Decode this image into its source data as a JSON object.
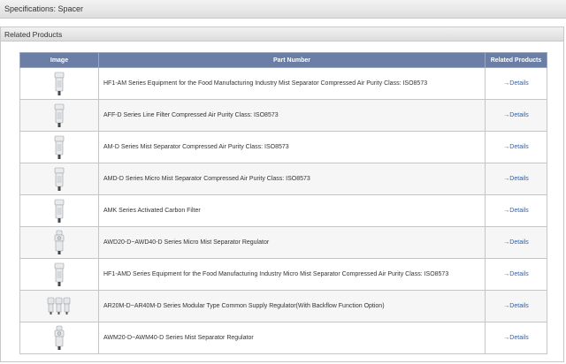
{
  "spec_title": "Specifications: Spacer",
  "related_title": "Related Products",
  "table": {
    "headers": [
      "Image",
      "Part Number",
      "Related Products"
    ],
    "rows": [
      {
        "part": "HF1-AM Series Equipment for the Food Manufacturing Industry Mist Separator Compressed Air Purity Class: ISO8573",
        "link": "Details",
        "arrow": "→",
        "img": "single-unit"
      },
      {
        "part": "AFF-D Series Line Filter Compressed Air Purity Class: ISO8573",
        "link": "Details",
        "arrow": "→",
        "img": "single-unit"
      },
      {
        "part": "AM-D Series Mist Separator Compressed Air Purity Class: ISO8573",
        "link": "Details",
        "arrow": "→",
        "img": "single-unit"
      },
      {
        "part": "AMD-D Series Micro Mist Separator Compressed Air Purity Class: ISO8573",
        "link": "Details",
        "arrow": "→",
        "img": "single-unit"
      },
      {
        "part": "AMK Series Activated Carbon Filter",
        "link": "Details",
        "arrow": "→",
        "img": "single-unit"
      },
      {
        "part": "AWD20-D~AWD40-D Series Micro Mist Separator Regulator",
        "link": "Details",
        "arrow": "→",
        "img": "regulator-unit"
      },
      {
        "part": "HF1-AMD Series Equipment for the Food Manufacturing Industry Micro Mist Separator Compressed Air Purity Class: ISO8573",
        "link": "Details",
        "arrow": "→",
        "img": "single-unit"
      },
      {
        "part": "AR20M-D~AR40M-D Series Modular Type Common Supply Regulator(With Backflow Function Option)",
        "link": "Details",
        "arrow": "→",
        "img": "triple-unit"
      },
      {
        "part": "AWM20-D~AWM40-D Series Mist Separator Regulator",
        "link": "Details",
        "arrow": "→",
        "img": "regulator-unit"
      }
    ]
  }
}
